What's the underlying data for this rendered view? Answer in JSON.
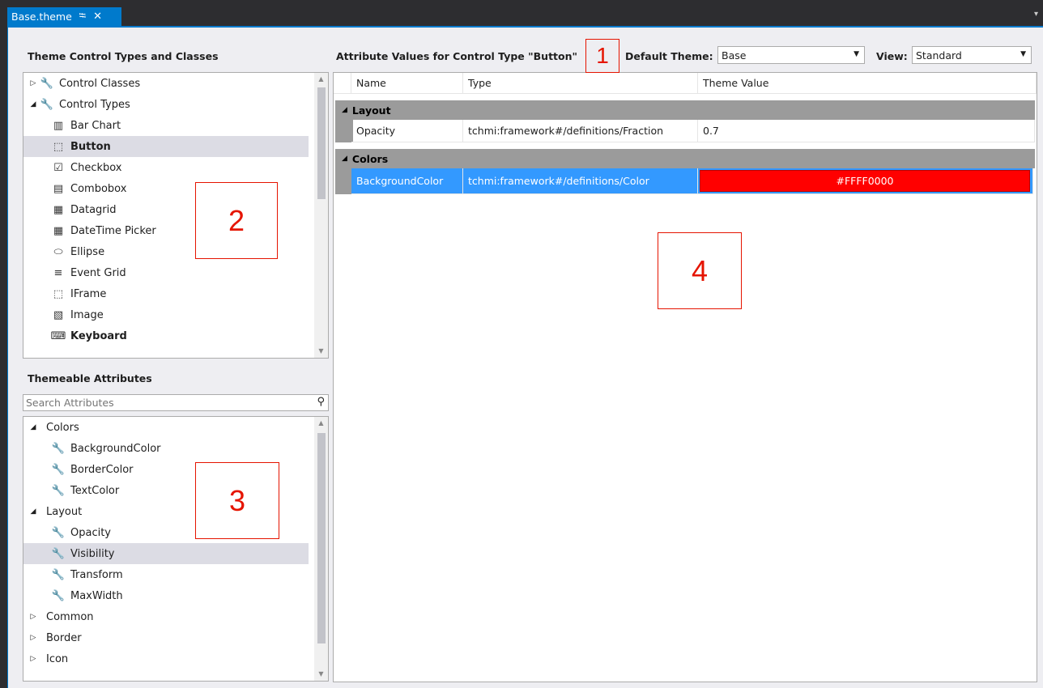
{
  "tab": {
    "title": "Base.theme",
    "pin": "⭾",
    "close": "✕"
  },
  "left_top": {
    "title": "Theme Control Types and Classes",
    "items": [
      {
        "label": "Control Classes",
        "expander": "▷",
        "icon": "wrench-icon",
        "glyph": "🔧"
      },
      {
        "label": "Control Types",
        "expander": "◢",
        "icon": "wrench-icon",
        "glyph": "🔧"
      },
      {
        "label": "Bar Chart",
        "icon": "bar-chart-icon",
        "glyph": "▥"
      },
      {
        "label": "Button",
        "icon": "button-cursor-icon",
        "glyph": "⬚"
      },
      {
        "label": "Checkbox",
        "icon": "checkbox-icon",
        "glyph": "☑"
      },
      {
        "label": "Combobox",
        "icon": "combobox-icon",
        "glyph": "▤"
      },
      {
        "label": "Datagrid",
        "icon": "datagrid-icon",
        "glyph": "▦"
      },
      {
        "label": "DateTime Picker",
        "icon": "calendar-icon",
        "glyph": "▦"
      },
      {
        "label": "Ellipse",
        "icon": "ellipse-icon",
        "glyph": "⬭"
      },
      {
        "label": "Event Grid",
        "icon": "event-grid-icon",
        "glyph": "≡"
      },
      {
        "label": "IFrame",
        "icon": "iframe-icon",
        "glyph": "⬚"
      },
      {
        "label": "Image",
        "icon": "image-icon",
        "glyph": "▧"
      },
      {
        "label": "Keyboard",
        "icon": "keyboard-icon",
        "glyph": "⌨"
      }
    ]
  },
  "left_bottom": {
    "title": "Themeable Attributes",
    "search_placeholder": "Search Attributes",
    "items": [
      {
        "label": "Colors",
        "expander": "◢"
      },
      {
        "label": "BackgroundColor",
        "icon": "wrench-icon",
        "glyph": "🔧"
      },
      {
        "label": "BorderColor",
        "icon": "wrench-icon",
        "glyph": "🔧"
      },
      {
        "label": "TextColor",
        "icon": "wrench-icon",
        "glyph": "🔧"
      },
      {
        "label": "Layout",
        "expander": "◢"
      },
      {
        "label": "Opacity",
        "icon": "wrench-icon",
        "glyph": "🔧"
      },
      {
        "label": "Visibility",
        "icon": "wrench-icon",
        "glyph": "🔧"
      },
      {
        "label": "Transform",
        "icon": "wrench-icon",
        "glyph": "🔧"
      },
      {
        "label": "MaxWidth",
        "icon": "wrench-icon",
        "glyph": "🔧"
      },
      {
        "label": "Common",
        "expander": "▷"
      },
      {
        "label": "Border",
        "expander": "▷"
      },
      {
        "label": "Icon",
        "expander": "▷"
      }
    ]
  },
  "right": {
    "title": "Attribute Values for Control Type \"Button\"",
    "default_theme_label": "Default Theme:",
    "default_theme_value": "Base",
    "view_label": "View:",
    "view_value": "Standard",
    "columns": [
      "Name",
      "Type",
      "Theme Value"
    ],
    "groups": [
      {
        "name": "Layout",
        "rows": [
          {
            "name": "Opacity",
            "type": "tchmi:framework#/definitions/Fraction",
            "value": "0.7"
          }
        ]
      },
      {
        "name": "Colors",
        "rows": [
          {
            "name": "BackgroundColor",
            "type": "tchmi:framework#/definitions/Color",
            "value": "#FFFF0000"
          }
        ]
      }
    ]
  },
  "callouts": {
    "c1": "1",
    "c2": "2",
    "c3": "3",
    "c4": "4"
  },
  "colors": {
    "accent": "#007acc",
    "selection": "#3399ff",
    "value_color": "#ff0000",
    "callout": "#e51400"
  }
}
